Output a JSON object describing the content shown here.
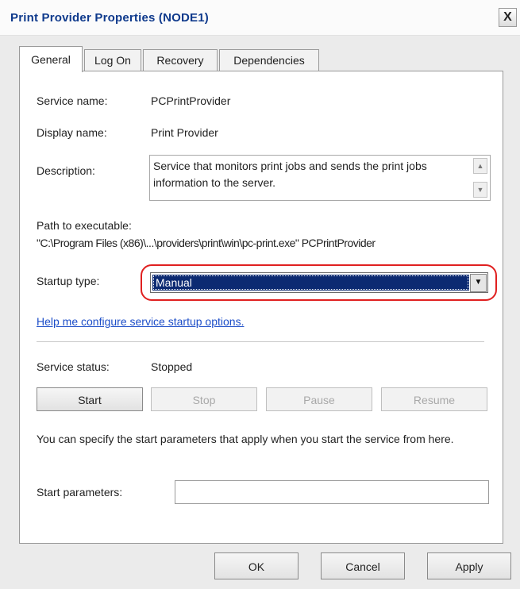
{
  "window": {
    "title": "Print Provider Properties (NODE1)",
    "close_label": "X"
  },
  "tabs": [
    {
      "label": "General",
      "active": true
    },
    {
      "label": "Log On",
      "active": false
    },
    {
      "label": "Recovery",
      "active": false
    },
    {
      "label": "Dependencies",
      "active": false
    }
  ],
  "general": {
    "service_name_label": "Service name:",
    "service_name_value": "PCPrintProvider",
    "display_name_label": "Display name:",
    "display_name_value": "Print Provider",
    "description_label": "Description:",
    "description_value": "Service that monitors print jobs and sends the print jobs information to the server.",
    "path_label": "Path to executable:",
    "path_value": "\"C:\\Program Files (x86)\\...\\providers\\print\\win\\pc-print.exe\" PCPrintProvider",
    "startup_type_label": "Startup type:",
    "startup_type_value": "Manual",
    "help_link": "Help me configure service startup options.",
    "service_status_label": "Service status:",
    "service_status_value": "Stopped",
    "buttons": {
      "start": "Start",
      "stop": "Stop",
      "pause": "Pause",
      "resume": "Resume"
    },
    "start_params_note": "You can specify the start parameters that apply when you start the service from here.",
    "start_params_label": "Start parameters:",
    "start_params_value": ""
  },
  "footer": {
    "ok": "OK",
    "cancel": "Cancel",
    "apply": "Apply"
  },
  "colors": {
    "title_text": "#0f3a8c",
    "selection": "#0c2a72",
    "highlight_ring": "#e02020",
    "link": "#1d4ec8"
  }
}
